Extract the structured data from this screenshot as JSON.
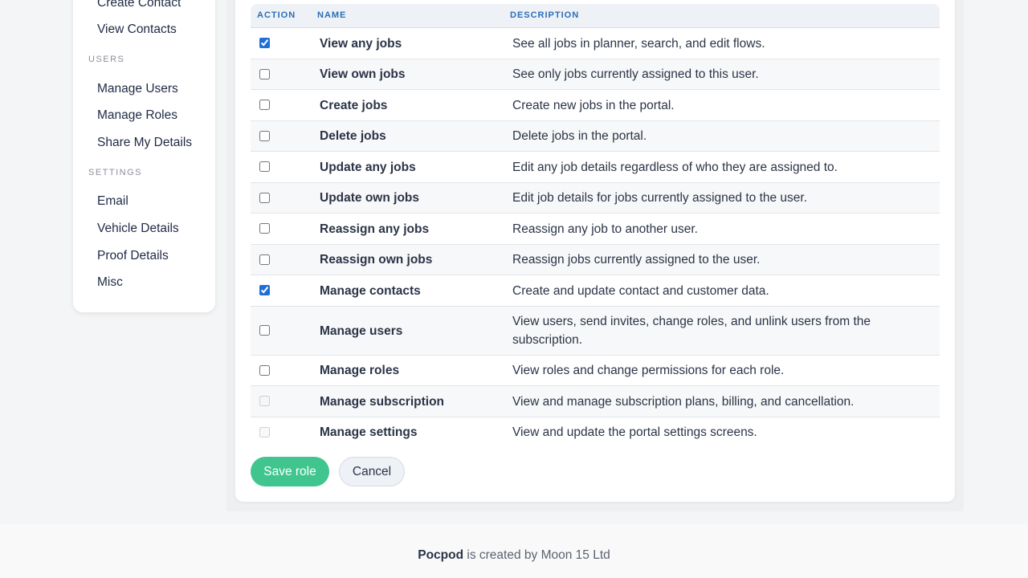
{
  "sidebar": {
    "items": [
      {
        "label": "Create Contact"
      },
      {
        "label": "View Contacts"
      }
    ],
    "sections": [
      {
        "title": "USERS",
        "items": [
          {
            "label": "Manage Users"
          },
          {
            "label": "Manage Roles"
          },
          {
            "label": "Share My Details"
          }
        ]
      },
      {
        "title": "SETTINGS",
        "items": [
          {
            "label": "Email"
          },
          {
            "label": "Vehicle Details"
          },
          {
            "label": "Proof Details"
          },
          {
            "label": "Misc"
          }
        ]
      }
    ]
  },
  "table": {
    "headers": {
      "action": "ACTION",
      "name": "NAME",
      "description": "DESCRIPTION"
    },
    "rows": [
      {
        "name": "View any jobs",
        "description": "See all jobs in planner, search, and edit flows.",
        "checked": true,
        "disabled": false
      },
      {
        "name": "View own jobs",
        "description": "See only jobs currently assigned to this user.",
        "checked": false,
        "disabled": false
      },
      {
        "name": "Create jobs",
        "description": "Create new jobs in the portal.",
        "checked": false,
        "disabled": false
      },
      {
        "name": "Delete jobs",
        "description": "Delete jobs in the portal.",
        "checked": false,
        "disabled": false
      },
      {
        "name": "Update any jobs",
        "description": "Edit any job details regardless of who they are assigned to.",
        "checked": false,
        "disabled": false
      },
      {
        "name": "Update own jobs",
        "description": "Edit job details for jobs currently assigned to the user.",
        "checked": false,
        "disabled": false
      },
      {
        "name": "Reassign any jobs",
        "description": "Reassign any job to another user.",
        "checked": false,
        "disabled": false
      },
      {
        "name": "Reassign own jobs",
        "description": "Reassign jobs currently assigned to the user.",
        "checked": false,
        "disabled": false
      },
      {
        "name": "Manage contacts",
        "description": "Create and update contact and customer data.",
        "checked": true,
        "disabled": false
      },
      {
        "name": "Manage users",
        "description": "View users, send invites, change roles, and unlink users from the subscription.",
        "checked": false,
        "disabled": false
      },
      {
        "name": "Manage roles",
        "description": "View roles and change permissions for each role.",
        "checked": false,
        "disabled": false
      },
      {
        "name": "Manage subscription",
        "description": "View and manage subscription plans, billing, and cancellation.",
        "checked": false,
        "disabled": true
      },
      {
        "name": "Manage settings",
        "description": "View and update the portal settings screens.",
        "checked": false,
        "disabled": true
      }
    ]
  },
  "actions": {
    "save_label": "Save role",
    "cancel_label": "Cancel"
  },
  "footer": {
    "brand": "Pocpod",
    "text": " is created by Moon 15 Ltd"
  },
  "colors": {
    "accent": "#41c58f",
    "header_text": "#2a6fb8",
    "checkbox": "#1e6fd9"
  }
}
